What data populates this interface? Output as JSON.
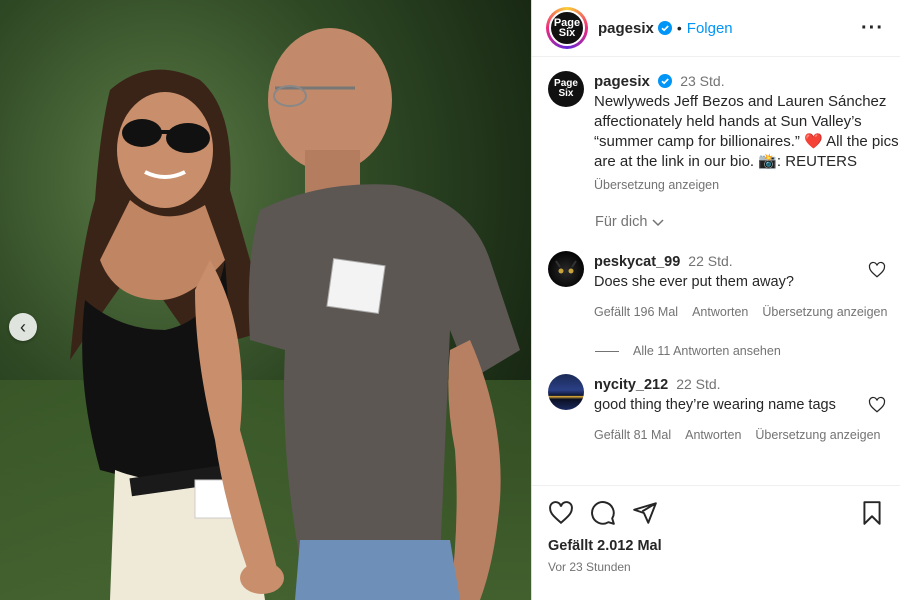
{
  "post": {
    "username": "pagesix",
    "follow_label": "Folgen",
    "avatar_text": "Page Six"
  },
  "caption": {
    "username": "pagesix",
    "time": "23 Std.",
    "text": "Newlyweds Jeff Bezos and Lauren Sánchez affectionately held hands at Sun Valley’s “summer camp for billionaires.” ❤️ All the pics are at the link in our bio. 📸: REUTERS",
    "translate": "Übersetzung anzeigen"
  },
  "for_you": "Für dich",
  "comments": [
    {
      "username": "peskycat_99",
      "time": "22 Std.",
      "text": "Does she ever put them away?",
      "likes": "Gefällt 196 Mal",
      "reply": "Antworten",
      "translate": "Übersetzung anzeigen"
    },
    {
      "username": "nycity_212",
      "time": "22 Std.",
      "text": "good thing they’re wearing name tags",
      "likes": "Gefällt 81 Mal",
      "reply": "Antworten",
      "translate": "Übersetzung anzeigen"
    }
  ],
  "view_replies": "Alle 11 Antworten ansehen",
  "footer": {
    "likes": "Gefällt 2.012 Mal",
    "ago": "Vor 23 Stunden"
  },
  "colors": {
    "accent": "#0095f6",
    "verified": "#0095f6",
    "heart_emoji": "#ed4956"
  },
  "icons": [
    "chevron-left-icon",
    "verified-icon",
    "more-icon",
    "heart-icon",
    "comment-icon",
    "share-icon",
    "bookmark-icon",
    "chevron-down-icon"
  ]
}
